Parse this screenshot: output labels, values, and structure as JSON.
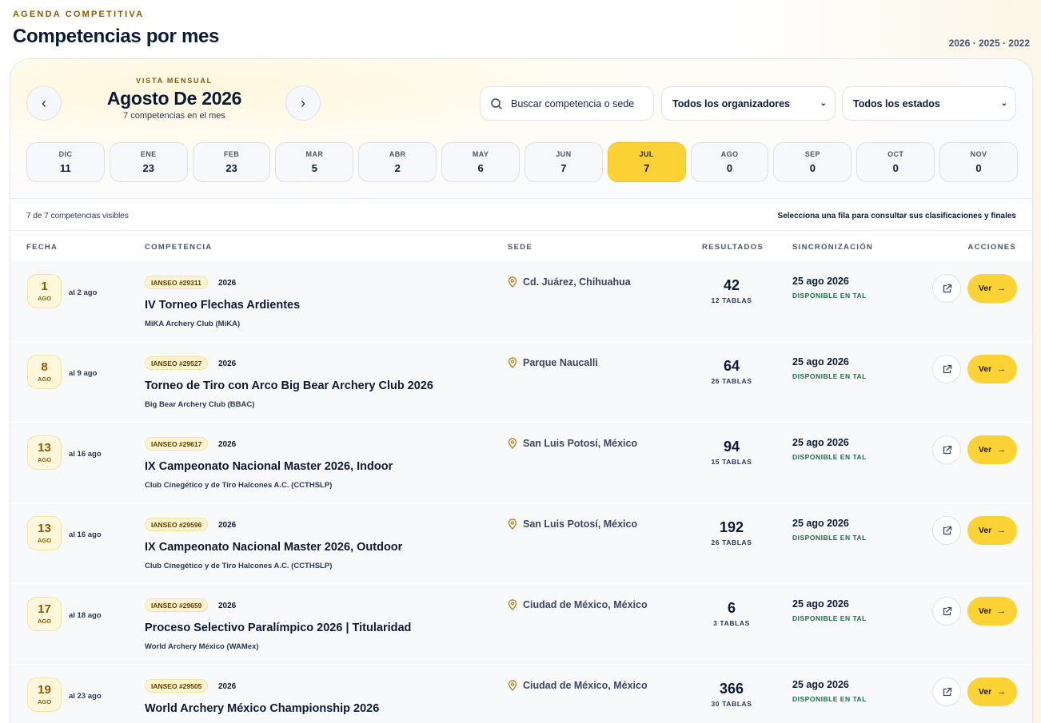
{
  "header": {
    "eyebrow": "AGENDA COMPETITIVA",
    "title": "Competencias por mes",
    "years": "2026 · 2025 · 2022"
  },
  "month_nav": {
    "eyebrow": "VISTA MENSUAL",
    "title": "Agosto De 2026",
    "count": "7 competencias en el mes"
  },
  "filters": {
    "search_placeholder": "Buscar competencia o sede",
    "organizer": "Todos los organizadores",
    "state": "Todos los estados"
  },
  "months": [
    {
      "label": "DIC",
      "count": "11"
    },
    {
      "label": "ENE",
      "count": "23"
    },
    {
      "label": "FEB",
      "count": "23"
    },
    {
      "label": "MAR",
      "count": "5"
    },
    {
      "label": "ABR",
      "count": "2"
    },
    {
      "label": "MAY",
      "count": "6"
    },
    {
      "label": "JUN",
      "count": "7"
    },
    {
      "label": "JUL",
      "count": "7",
      "active": true
    },
    {
      "label": "AGO",
      "count": "0"
    },
    {
      "label": "SEP",
      "count": "0"
    },
    {
      "label": "OCT",
      "count": "0"
    },
    {
      "label": "NOV",
      "count": "0"
    }
  ],
  "toolbar": {
    "visible": "7 de 7 competencias visibles",
    "hint": "Selecciona una fila para consultar sus clasificaciones y finales"
  },
  "columns": {
    "fecha": "FECHA",
    "competencia": "COMPETENCIA",
    "sede": "SEDE",
    "resultados": "RESULTADOS",
    "sincronizacion": "SINCRONIZACIÓN",
    "acciones": "ACCIONES"
  },
  "rows": [
    {
      "day": "1",
      "month": "AGO",
      "until": "al 2 ago",
      "tag": "IANSEO #29311",
      "year": "2026",
      "name": "IV Torneo Flechas Ardientes",
      "org": "MiKA Archery Club (MiKA)",
      "venue": "Cd. Juárez, Chihuahua",
      "results": "42",
      "tables": "12 TABLAS",
      "sync_date": "25 ago 2026",
      "sync_status": "DISPONIBLE EN TAL",
      "action": "Ver"
    },
    {
      "day": "8",
      "month": "AGO",
      "until": "al 9 ago",
      "tag": "IANSEO #29527",
      "year": "2026",
      "name": "Torneo de Tiro con Arco Big Bear Archery Club 2026",
      "org": "Big Bear Archery Club (BBAC)",
      "venue": "Parque Naucalli",
      "results": "64",
      "tables": "26 TABLAS",
      "sync_date": "25 ago 2026",
      "sync_status": "DISPONIBLE EN TAL",
      "action": "Ver"
    },
    {
      "day": "13",
      "month": "AGO",
      "until": "al 16 ago",
      "tag": "IANSEO #29617",
      "year": "2026",
      "name": "IX Campeonato Nacional Master 2026, Indoor",
      "org": "Club Cinegético y de Tiro Halcones A.C. (CCTHSLP)",
      "venue": "San Luis Potosí, México",
      "results": "94",
      "tables": "15 TABLAS",
      "sync_date": "25 ago 2026",
      "sync_status": "DISPONIBLE EN TAL",
      "action": "Ver"
    },
    {
      "day": "13",
      "month": "AGO",
      "until": "al 16 ago",
      "tag": "IANSEO #29596",
      "year": "2026",
      "name": "IX Campeonato Nacional Master 2026, Outdoor",
      "org": "Club Cinegético y de Tiro Halcones A.C. (CCTHSLP)",
      "venue": "San Luis Potosí, México",
      "results": "192",
      "tables": "26 TABLAS",
      "sync_date": "25 ago 2026",
      "sync_status": "DISPONIBLE EN TAL",
      "action": "Ver"
    },
    {
      "day": "17",
      "month": "AGO",
      "until": "al 18 ago",
      "tag": "IANSEO #29659",
      "year": "2026",
      "name": "Proceso Selectivo Paralímpico 2026 | Titularidad",
      "org": "World Archery México (WAMex)",
      "venue": "Ciudad de México, México",
      "results": "6",
      "tables": "3 TABLAS",
      "sync_date": "25 ago 2026",
      "sync_status": "DISPONIBLE EN TAL",
      "action": "Ver"
    },
    {
      "day": "19",
      "month": "AGO",
      "until": "al 23 ago",
      "tag": "IANSEO #29505",
      "year": "2026",
      "name": "World Archery México Championship 2026",
      "org": "",
      "venue": "Ciudad de México, México",
      "results": "366",
      "tables": "30 TABLAS",
      "sync_date": "25 ago 2026",
      "sync_status": "DISPONIBLE EN TAL",
      "action": "Ver"
    }
  ],
  "icons": {
    "prev": "chevron-left-icon",
    "next": "chevron-right-icon",
    "search": "search-icon",
    "pin": "map-pin-icon",
    "external": "external-link-icon",
    "arrow": "arrow-right-icon"
  },
  "colors": {
    "accent": "#fdd235",
    "brown": "#8a5a00",
    "green": "#1b6e43"
  }
}
